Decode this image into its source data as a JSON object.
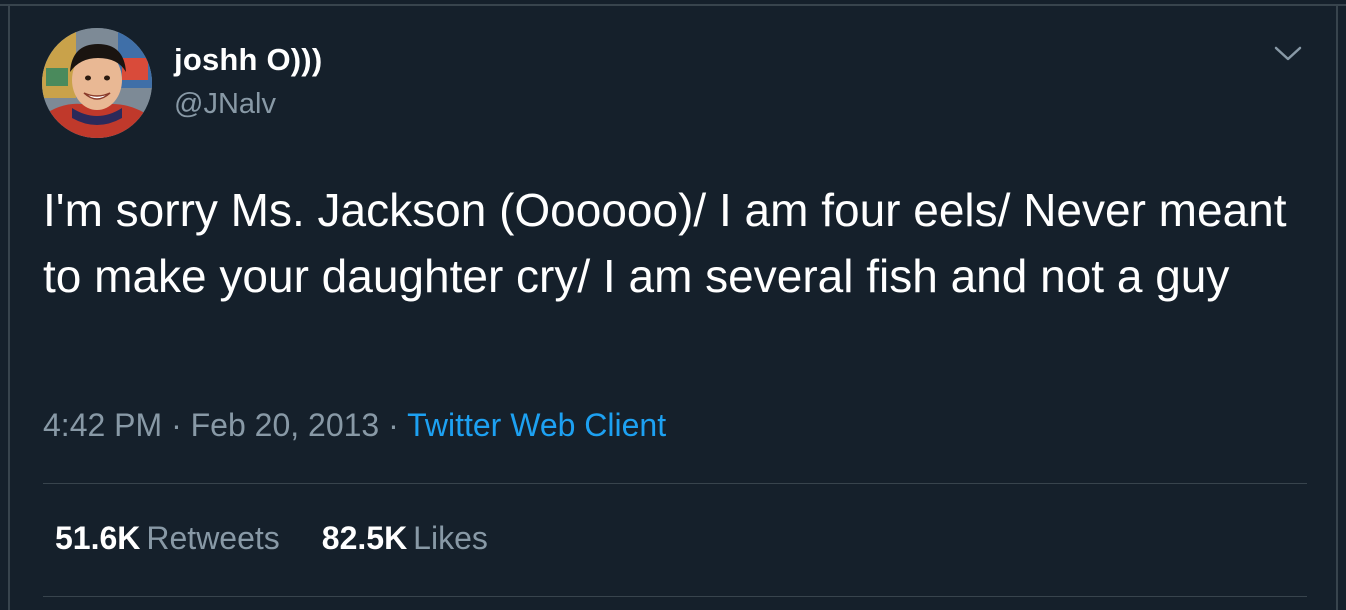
{
  "user": {
    "display_name": "joshh O)))",
    "handle": "@JNalv"
  },
  "tweet": {
    "text": "I'm sorry Ms. Jackson (Oooooo)/ I am four eels/ Never meant to make your daughter cry/ I am several fish and not a guy"
  },
  "meta": {
    "time": "4:42 PM",
    "separator_1": " · ",
    "date": "Feb 20, 2013",
    "separator_2": " · ",
    "source": "Twitter Web Client"
  },
  "stats": {
    "retweets_count": "51.6K",
    "retweets_label": "Retweets",
    "likes_count": "82.5K",
    "likes_label": "Likes"
  },
  "colors": {
    "background": "#15202b",
    "text": "#ffffff",
    "secondary": "#8899a6",
    "accent": "#1da1f2",
    "border": "#38444d"
  },
  "icons": {
    "menu": "chevron-down-icon",
    "avatar": "user-avatar-photo"
  }
}
